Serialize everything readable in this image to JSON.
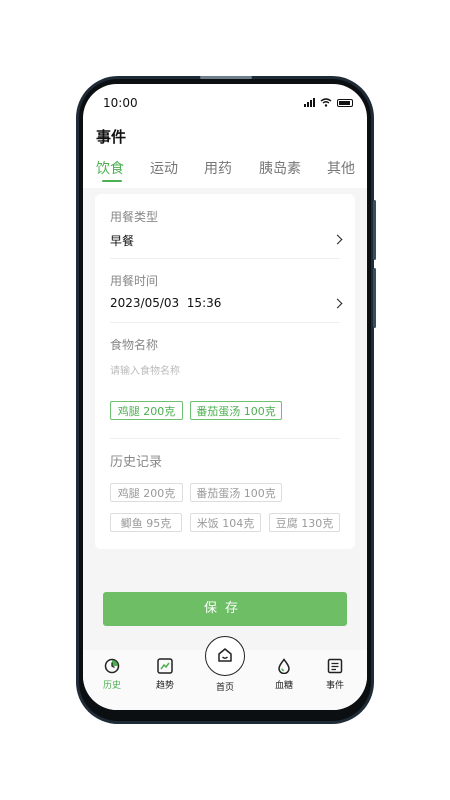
{
  "status_bar": {
    "time": "10:00"
  },
  "page": {
    "title": "事件"
  },
  "tabs": [
    {
      "label": "饮食",
      "active": true
    },
    {
      "label": "运动",
      "active": false
    },
    {
      "label": "用药",
      "active": false
    },
    {
      "label": "胰岛素",
      "active": false
    },
    {
      "label": "其他",
      "active": false
    }
  ],
  "form": {
    "meal_type": {
      "label": "用餐类型",
      "value": "早餐"
    },
    "meal_time": {
      "label": "用餐时间",
      "value": "2023/05/03  15:36"
    },
    "food_name": {
      "label": "食物名称",
      "placeholder": "请输入食物名称"
    },
    "selected_foods": [
      "鸡腿 200克",
      "番茄蛋汤 100克"
    ],
    "history": {
      "label": "历史记录",
      "items": [
        "鸡腿 200克",
        "番茄蛋汤 100克",
        "鲫鱼 95克",
        "米饭 104克",
        "豆腐 130克"
      ]
    }
  },
  "save_button": {
    "label": "保存"
  },
  "bottom_nav": {
    "items": [
      {
        "label": "历史",
        "icon": "history-icon",
        "active": true
      },
      {
        "label": "趋势",
        "icon": "trend-icon",
        "active": false
      },
      {
        "label": "首页",
        "icon": "home-icon",
        "active": false
      },
      {
        "label": "血糖",
        "icon": "blood-drop-icon",
        "active": false
      },
      {
        "label": "事件",
        "icon": "event-list-icon",
        "active": false
      }
    ]
  },
  "colors": {
    "accent": "#4caf50",
    "save_button": "#6dbe65",
    "background": "#f5f5f5"
  }
}
